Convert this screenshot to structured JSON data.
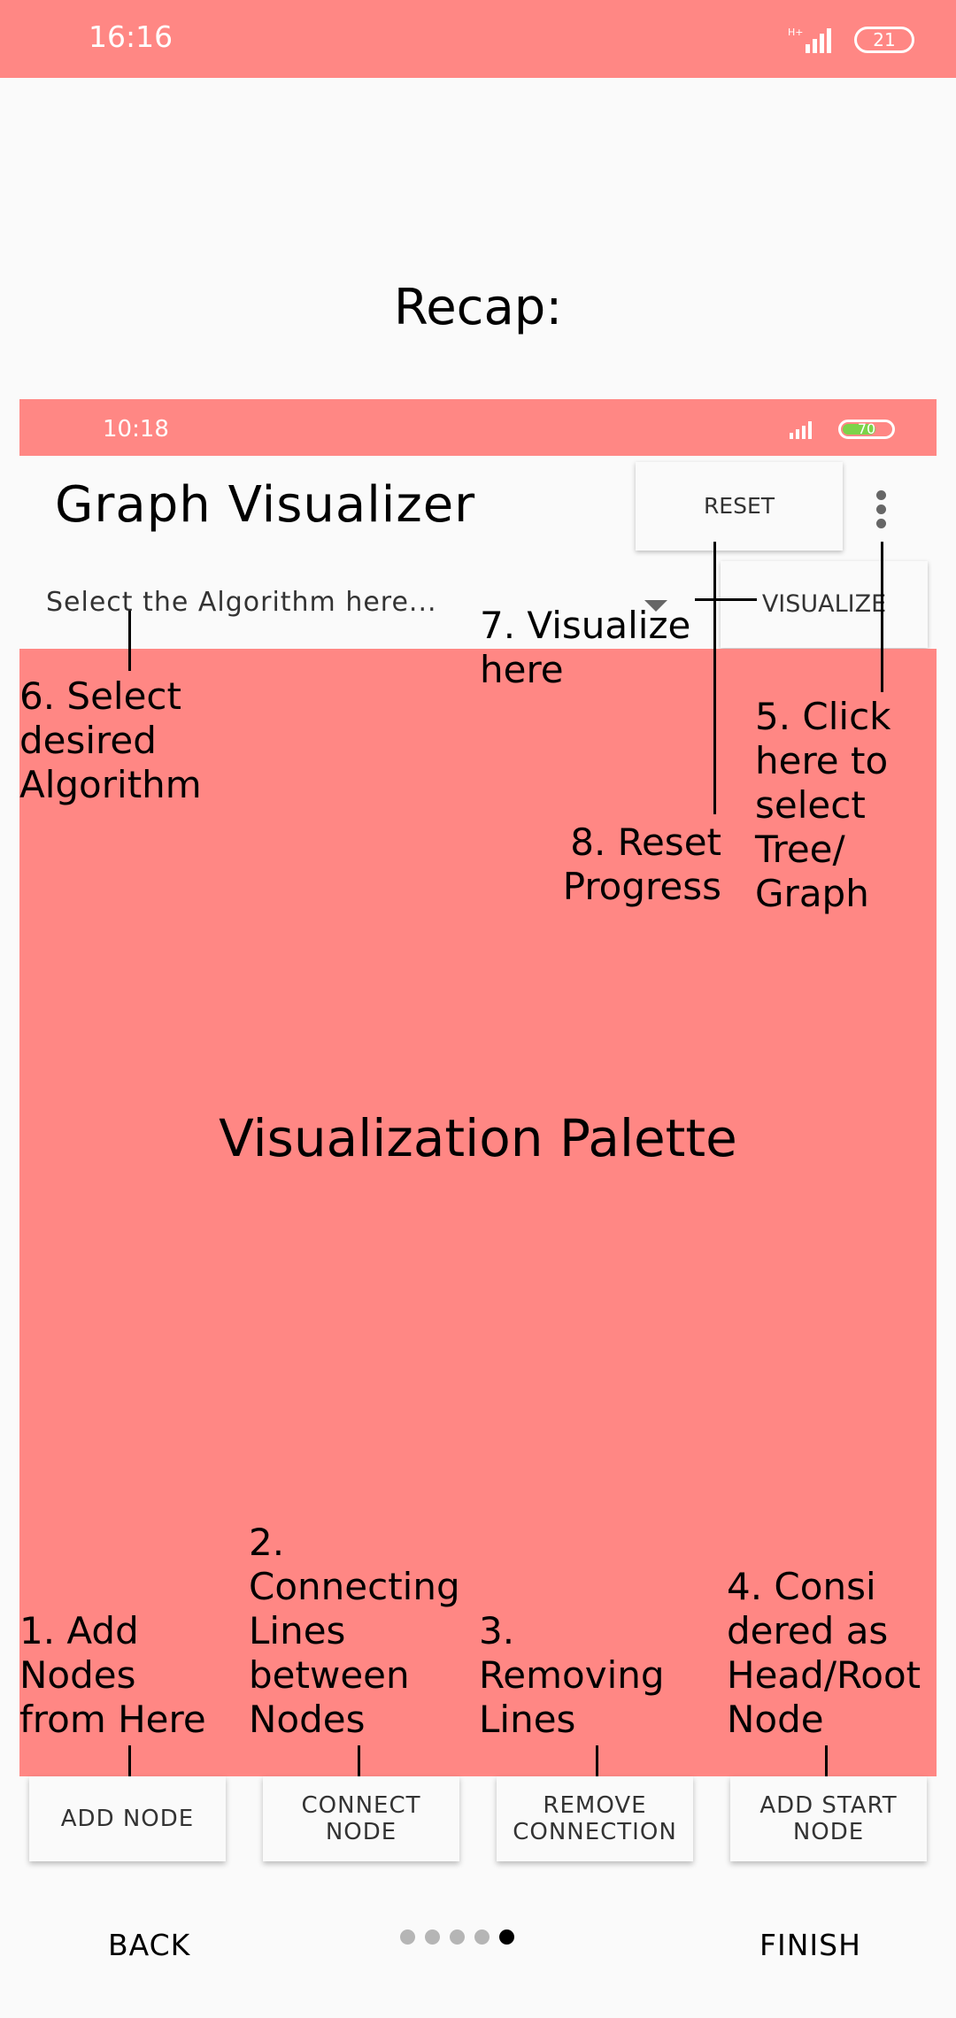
{
  "status_bar": {
    "time": "16:16",
    "battery": "21",
    "network": "H+"
  },
  "recap_title": "Recap:",
  "inner_screen": {
    "status_time": "10:18",
    "battery": "70",
    "app_title": "Graph Visualizer",
    "reset_label": "RESET",
    "select_placeholder": "Select the Algorithm here...",
    "visualize_label": "VISUALIZE",
    "palette_label": "Visualization Palette",
    "bottom_buttons": [
      "ADD NODE",
      "CONNECT NODE",
      "REMOVE CONNECTION",
      "ADD START NODE"
    ]
  },
  "annotations": {
    "n1": "1. Add Nodes from Here",
    "n2": "2. Connecting Lines between Nodes",
    "n3": "3. Removing Lines",
    "n4": "4. Consi dered as Head/Root Node",
    "n5": "5. Click here to select Tree/ Graph",
    "n6": "6. Select desired Algorithm",
    "n7": "7. Visualize here",
    "n8": "8. Reset Progress"
  },
  "navigation": {
    "back_label": "BACK",
    "finish_label": "FINISH",
    "pages_total": 5,
    "current_page": 5
  },
  "colors": {
    "accent": "#ff8784",
    "background": "#fafafa"
  }
}
